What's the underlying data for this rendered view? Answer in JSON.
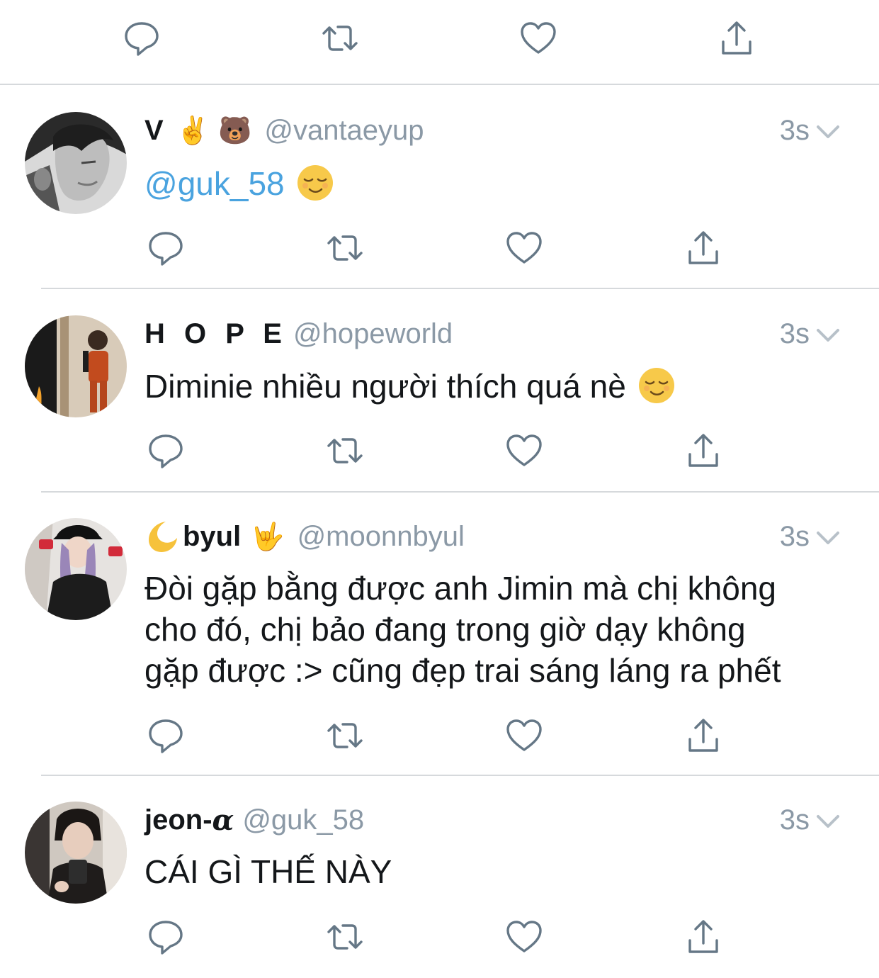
{
  "top_actions": {
    "reply_icon": "reply-icon",
    "retweet_icon": "retweet-icon",
    "like_icon": "heart-icon",
    "share_icon": "share-icon"
  },
  "tweets": [
    {
      "display_name": "V",
      "name_emojis": [
        "✌️",
        "🐻"
      ],
      "handle": "@vantaeyup",
      "time": "3s",
      "mention": "@guk_58",
      "text": "",
      "trailing_emoji": "😌"
    },
    {
      "display_name": "H O P E",
      "handle": "@hopeworld",
      "time": "3s",
      "text": "Diminie nhiều người thích quá nè",
      "trailing_emoji": "😌"
    },
    {
      "display_name": "byul",
      "name_prefix_emoji": "🌙",
      "name_emojis": [
        "🤟"
      ],
      "handle": "@moonnbyul",
      "time": "3s",
      "text_lines": [
        "Đòi gặp bằng được anh Jimin mà chị không",
        "cho đó, chị bảo đang trong giờ dạy không",
        "gặp được :> cũng đẹp trai sáng láng ra phết"
      ]
    },
    {
      "display_name": "jeon-",
      "name_suffix": "α",
      "handle": "@guk_58",
      "time": "3s",
      "text": "CÁI GÌ THẾ NÀY"
    }
  ],
  "colors": {
    "text": "#14171a",
    "secondary": "#8b99a6",
    "icon": "#657786",
    "link": "#4aa3df",
    "divider": "#d6d9dc"
  }
}
